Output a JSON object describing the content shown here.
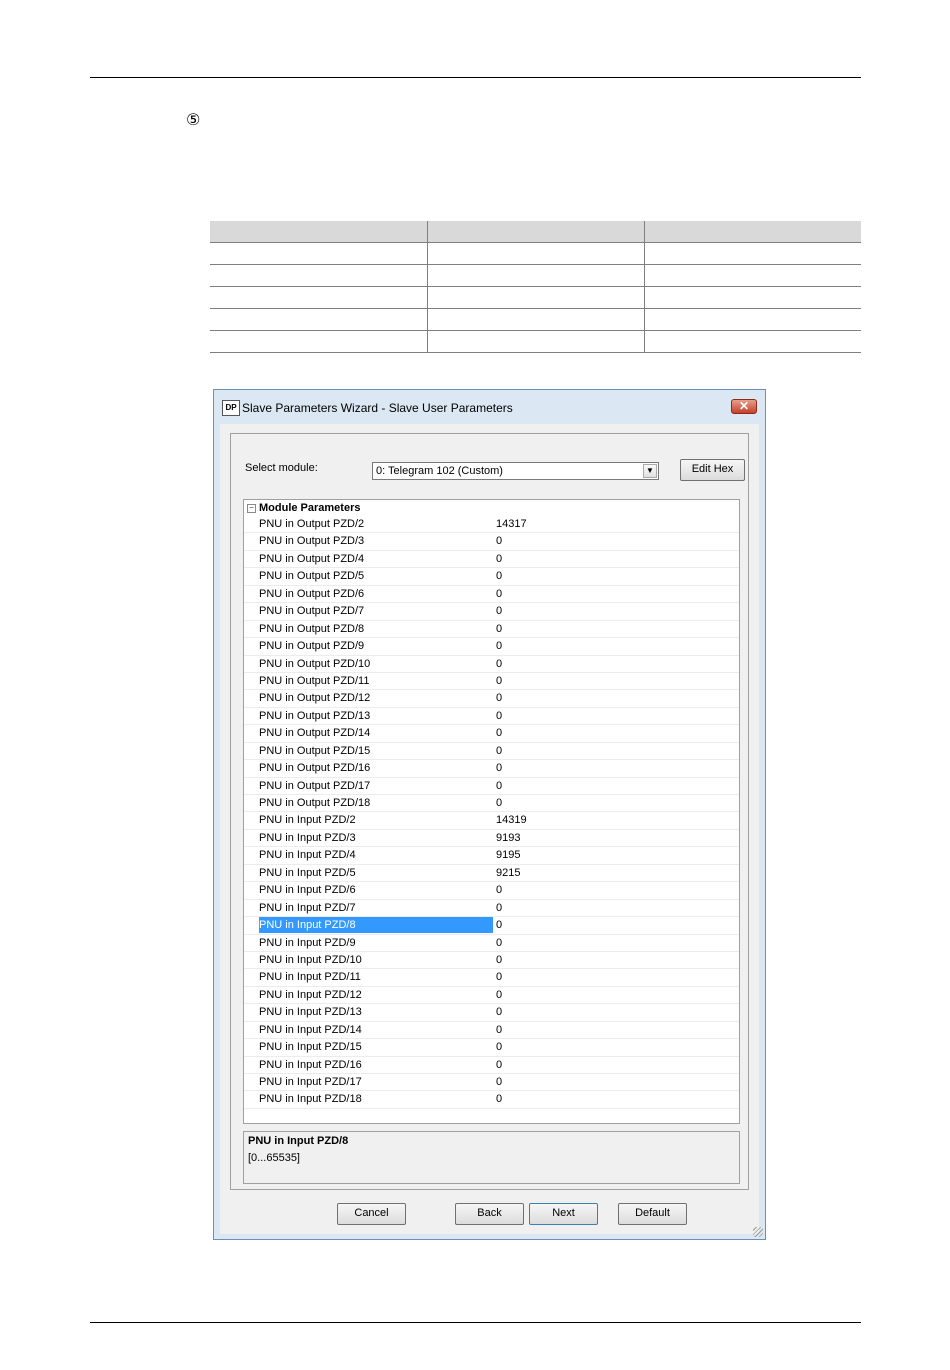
{
  "document": {
    "step_marker": "⑤"
  },
  "dialog": {
    "icon_text": "DP",
    "title": "Slave Parameters Wizard - Slave User Parameters",
    "close_symbol": "✕",
    "select_module_label": "Select module:",
    "select_module_value": "0: Telegram 102 (Custom)",
    "edit_hex_label": "Edit Hex",
    "group_title": "Module Parameters",
    "parameters": [
      {
        "name": "PNU in Output PZD/2",
        "value": "14317"
      },
      {
        "name": "PNU in Output PZD/3",
        "value": "0"
      },
      {
        "name": "PNU in Output PZD/4",
        "value": "0"
      },
      {
        "name": "PNU in Output PZD/5",
        "value": "0"
      },
      {
        "name": "PNU in Output PZD/6",
        "value": "0"
      },
      {
        "name": "PNU in Output PZD/7",
        "value": "0"
      },
      {
        "name": "PNU in Output PZD/8",
        "value": "0"
      },
      {
        "name": "PNU in Output PZD/9",
        "value": "0"
      },
      {
        "name": "PNU in Output PZD/10",
        "value": "0"
      },
      {
        "name": "PNU in Output PZD/11",
        "value": "0"
      },
      {
        "name": "PNU in Output PZD/12",
        "value": "0"
      },
      {
        "name": "PNU in Output PZD/13",
        "value": "0"
      },
      {
        "name": "PNU in Output PZD/14",
        "value": "0"
      },
      {
        "name": "PNU in Output PZD/15",
        "value": "0"
      },
      {
        "name": "PNU in Output PZD/16",
        "value": "0"
      },
      {
        "name": "PNU in Output PZD/17",
        "value": "0"
      },
      {
        "name": "PNU in Output PZD/18",
        "value": "0"
      },
      {
        "name": "PNU in Input PZD/2",
        "value": "14319"
      },
      {
        "name": "PNU in Input PZD/3",
        "value": "9193"
      },
      {
        "name": "PNU in Input PZD/4",
        "value": "9195"
      },
      {
        "name": "PNU in Input PZD/5",
        "value": "9215"
      },
      {
        "name": "PNU in Input PZD/6",
        "value": "0"
      },
      {
        "name": "PNU in Input PZD/7",
        "value": "0"
      },
      {
        "name": "PNU in Input PZD/8",
        "value": "0",
        "selected": true
      },
      {
        "name": "PNU in Input PZD/9",
        "value": "0"
      },
      {
        "name": "PNU in Input PZD/10",
        "value": "0"
      },
      {
        "name": "PNU in Input PZD/11",
        "value": "0"
      },
      {
        "name": "PNU in Input PZD/12",
        "value": "0"
      },
      {
        "name": "PNU in Input PZD/13",
        "value": "0"
      },
      {
        "name": "PNU in Input PZD/14",
        "value": "0"
      },
      {
        "name": "PNU in Input PZD/15",
        "value": "0"
      },
      {
        "name": "PNU in Input PZD/16",
        "value": "0"
      },
      {
        "name": "PNU in Input PZD/17",
        "value": "0"
      },
      {
        "name": "PNU in Input PZD/18",
        "value": "0"
      }
    ],
    "description_title": "PNU in Input PZD/8",
    "description_range": "[0...65535]",
    "buttons": {
      "cancel": "Cancel",
      "back": "Back",
      "next": "Next",
      "default": "Default"
    },
    "selection_color": "#3399ff"
  }
}
